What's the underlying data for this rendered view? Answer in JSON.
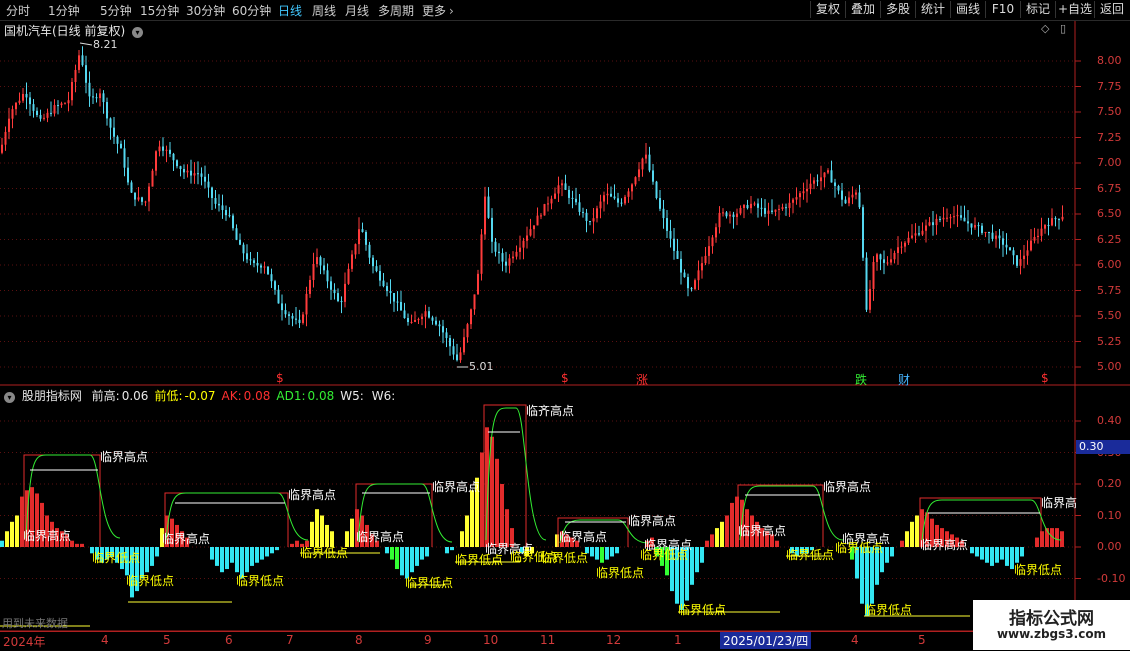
{
  "toolbar": {
    "periods": [
      "分时",
      "1分钟",
      "5分钟",
      "15分钟",
      "30分钟",
      "60分钟",
      "日线",
      "周线",
      "月线",
      "多周期",
      "更多"
    ],
    "active_period": "日线",
    "more_icon": "chevron-right-icon",
    "buttons": [
      "复权",
      "叠加",
      "多股",
      "统计",
      "画线",
      "F10",
      "标记",
      "+自选",
      "返回"
    ]
  },
  "price_panel": {
    "title": "国机汽车(日线 前复权)",
    "high_label": "8.21",
    "low_label": "5.01",
    "axis_ticks": [
      "8.00",
      "7.75",
      "7.50",
      "7.25",
      "7.00",
      "6.75",
      "6.50",
      "6.25",
      "6.00",
      "5.75",
      "5.50",
      "5.25",
      "5.00"
    ],
    "markers": [
      {
        "text": "$",
        "color": "#ff3030"
      },
      {
        "text": "$",
        "color": "#ff3030"
      },
      {
        "text": "涨",
        "color": "#ff3030"
      },
      {
        "text": "跌",
        "color": "#33ee33"
      },
      {
        "text": "财",
        "color": "#46b4ff"
      },
      {
        "text": "$",
        "color": "#ff3030"
      }
    ]
  },
  "indicator_panel": {
    "name": "股朋指标网",
    "legend": [
      {
        "label": "前高:",
        "value": "0.06",
        "color": "#e8e8e8"
      },
      {
        "label": "前低:",
        "value": "-0.07",
        "color": "#ffff00"
      },
      {
        "label": "AK:",
        "value": "0.08",
        "color": "#ff3030"
      },
      {
        "label": "AD1:",
        "value": "0.08",
        "color": "#33ee33"
      },
      {
        "label": "W5:",
        "value": "",
        "color": "#e8e8e8"
      },
      {
        "label": "W6:",
        "value": "",
        "color": "#e8e8e8"
      }
    ],
    "axis_ticks": [
      "0.40",
      "0.30",
      "0.20",
      "0.10",
      "0.00",
      "-0.10"
    ],
    "current_value": "0.30",
    "annotations": {
      "high": "临界高点",
      "low": "临界低点",
      "high_alt": "临齐高点",
      "high_cut": "临界高"
    },
    "footer_text": "用到未来数据"
  },
  "date_axis": {
    "labels": [
      "2024年",
      "4",
      "5",
      "6",
      "7",
      "8",
      "9",
      "10",
      "11",
      "12",
      "1",
      "4",
      "5"
    ],
    "cursor_date": "2025/01/23/四"
  },
  "watermark": {
    "title": "指标公式网",
    "url": "www.zbgs3.com"
  },
  "colors": {
    "up": "#ff3b3b",
    "down": "#55d8f0",
    "active_tab": "#41c8ff",
    "grid": "#5a1010",
    "panel_border": "#b02020"
  }
}
